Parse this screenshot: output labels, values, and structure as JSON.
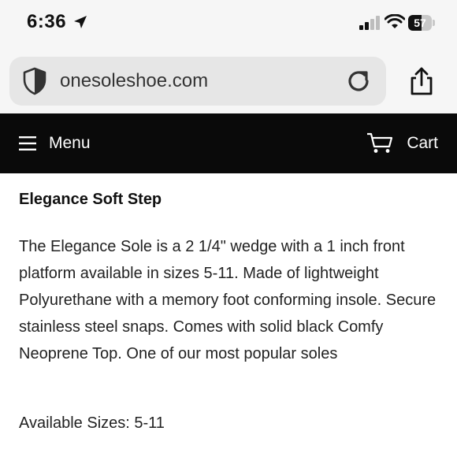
{
  "status_bar": {
    "time": "6:36",
    "battery": "57",
    "battery_level": 0.57,
    "icons": [
      "location-arrow-icon",
      "signal-icon",
      "wifi-icon",
      "battery-icon"
    ]
  },
  "browser": {
    "url": "onesoleshoe.com",
    "icons": [
      "shield-icon",
      "reload-icon",
      "share-icon"
    ]
  },
  "header": {
    "menu_label": "Menu",
    "cart_label": "Cart",
    "background": "#0a0a0a",
    "icons": [
      "hamburger-icon",
      "cart-icon"
    ]
  },
  "product": {
    "title": "Elegance Soft Step",
    "description": "The Elegance Sole is a 2 1/4\" wedge with a 1 inch front platform available in sizes 5-11. Made of lightweight Polyurethane with a memory foot conforming insole. Secure stainless steel snaps. Comes with solid black Comfy Neoprene Top. One of our most popular soles",
    "sizes": "Available Sizes: 5-11"
  }
}
